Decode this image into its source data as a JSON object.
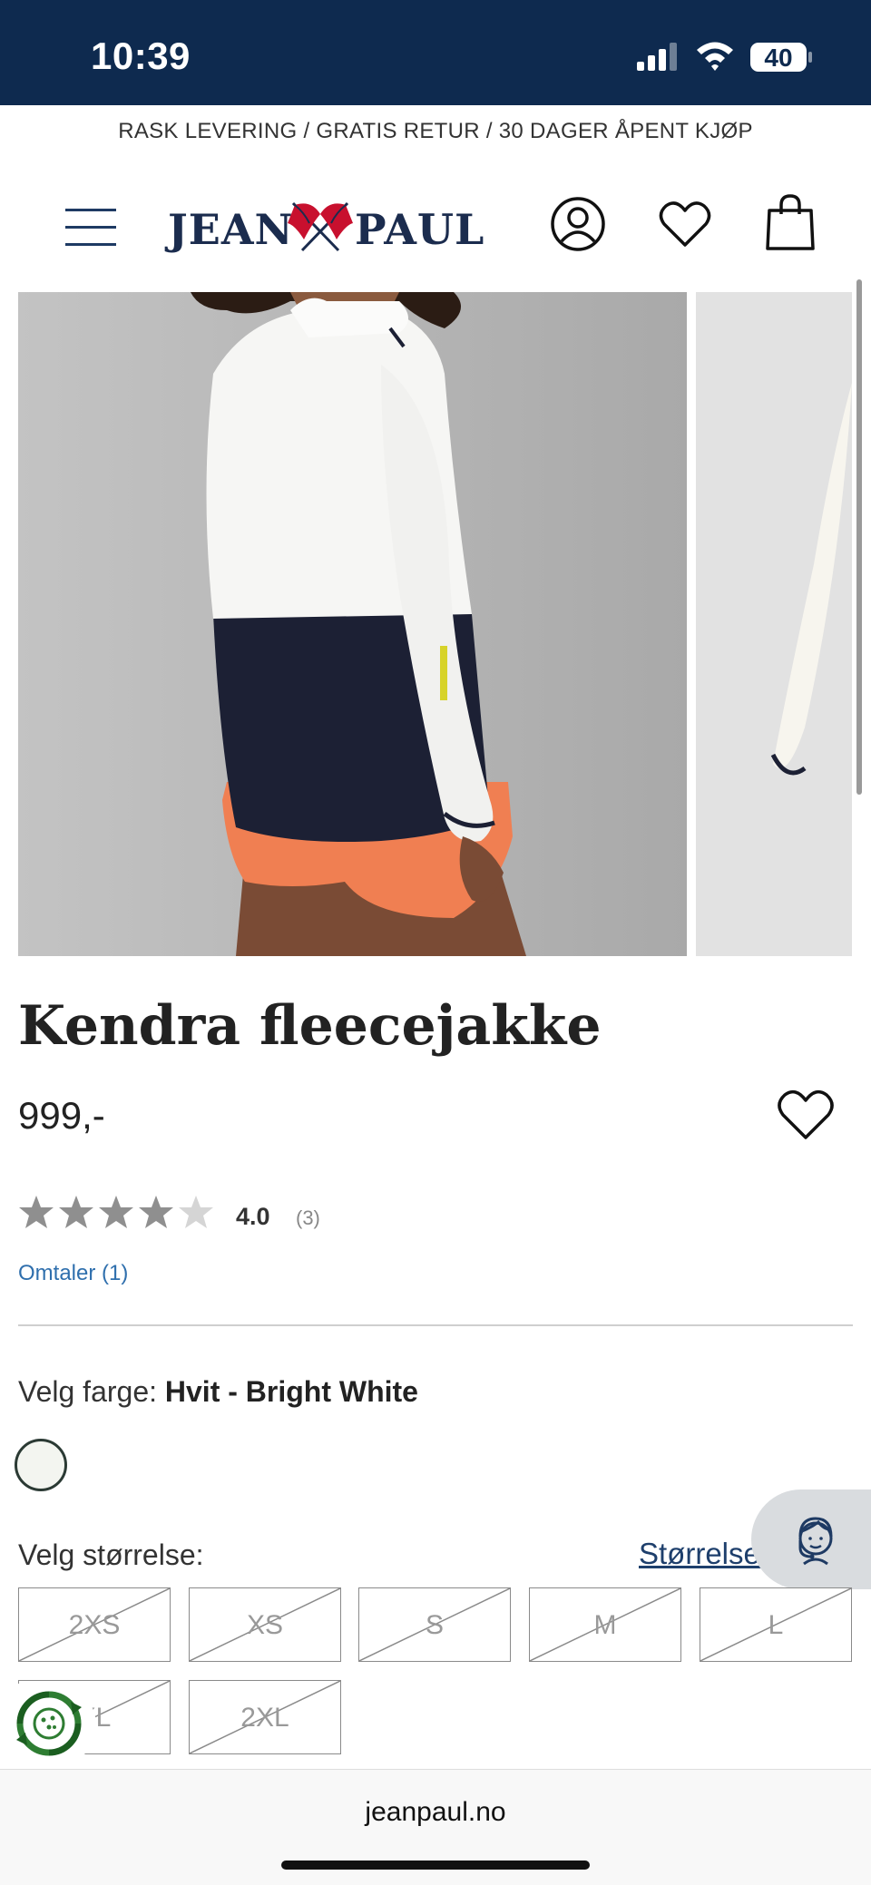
{
  "status": {
    "time": "10:39",
    "battery": "40"
  },
  "promo": {
    "text": "RASK LEVERING / GRATIS RETUR / 30 DAGER ÅPENT KJØP"
  },
  "header": {
    "logo_left": "JEAN",
    "logo_right": "PAUL",
    "icons": [
      "menu-icon",
      "user-icon",
      "heart-icon",
      "shopping-bag-icon"
    ]
  },
  "product": {
    "title": "Kendra fleecejakke",
    "price": "999,-",
    "rating_value": "4.0",
    "rating_count": "(3)",
    "rating_stars": 4,
    "rating_max": 5,
    "reviews_link": "Omtaler (1)",
    "color_prefix": "Velg farge:",
    "color_name": "Hvit - Bright White",
    "swatch_color": "#f3f5f0",
    "size_label": "Velg størrelse:",
    "size_guide": "Størrelsesguide",
    "sizes": [
      "2XS",
      "XS",
      "S",
      "M",
      "L",
      "XL",
      "2XL"
    ],
    "sizes_available": false
  },
  "colors": {
    "brand_navy": "#0e2a4f",
    "link_blue": "#2f6fad",
    "star_filled": "#8f8f8f",
    "star_empty": "#d5d5d5"
  },
  "browser": {
    "url": "jeanpaul.no"
  }
}
